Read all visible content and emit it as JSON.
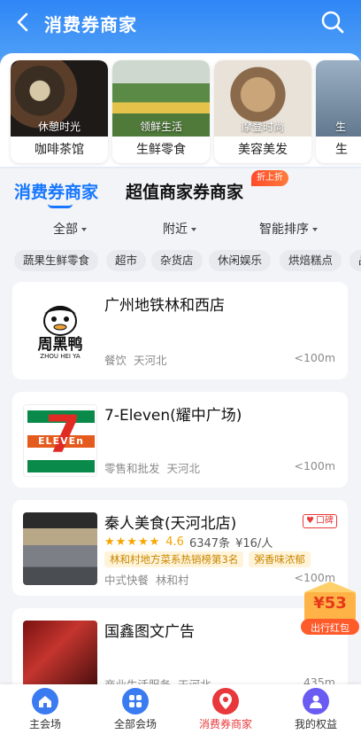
{
  "header": {
    "title": "消费券商家"
  },
  "categories": [
    {
      "tag": "休憩时光",
      "name": "咖啡茶馆",
      "icon": "coffee-image"
    },
    {
      "tag": "领鲜生活",
      "name": "生鲜零食",
      "icon": "market-image"
    },
    {
      "tag": "摩登时尚",
      "name": "美容美发",
      "icon": "hair-image"
    },
    {
      "tag": "生",
      "name": "生",
      "icon": "shop-image"
    }
  ],
  "tabs": {
    "primary": "消费券商家",
    "secondary": "超值商家券商家",
    "sale_badge": "折上折"
  },
  "filters": [
    "全部",
    "附近",
    "智能排序"
  ],
  "chips": [
    "蔬果生鲜零食",
    "超市",
    "杂货店",
    "休闲娱乐",
    "烘焙糕点",
    "品"
  ],
  "merchants": [
    {
      "name": "广州地铁林和西店",
      "category": "餐饮",
      "area": "天河北",
      "distance": "<100m",
      "logo_text": "周黑鸭",
      "logo_sub": "ZHOU HEI YA"
    },
    {
      "name": "7-Eleven(耀中广场)",
      "category": "零售和批发",
      "area": "天河北",
      "distance": "<100m",
      "logo_text": "ELEVEn",
      "logo_num": "7"
    },
    {
      "name": "秦人美食(天河北店)",
      "category": "中式快餐",
      "area": "林和村",
      "distance": "<100m",
      "stars": "★★★★★",
      "score": "4.6",
      "reviews": "6347条",
      "price": "¥16/人",
      "rank_tag": "林和村地方菜系热销榜第3名",
      "flavor_tag": "粥香味浓郁",
      "koubei": "口碑"
    },
    {
      "name": "国鑫图文广告",
      "category": "商业生活服务",
      "area": "天河北",
      "distance": "435m"
    }
  ],
  "redpack": {
    "amount": "¥53",
    "label": "出行红包"
  },
  "bottom_nav": [
    {
      "label": "主会场",
      "icon": "home-icon"
    },
    {
      "label": "全部会场",
      "icon": "grid-icon"
    },
    {
      "label": "消费券商家",
      "icon": "location-icon"
    },
    {
      "label": "我的权益",
      "icon": "user-icon"
    }
  ],
  "colors": {
    "accent": "#1677ff",
    "active_red": "#e8383b",
    "star": "#f7a500"
  }
}
